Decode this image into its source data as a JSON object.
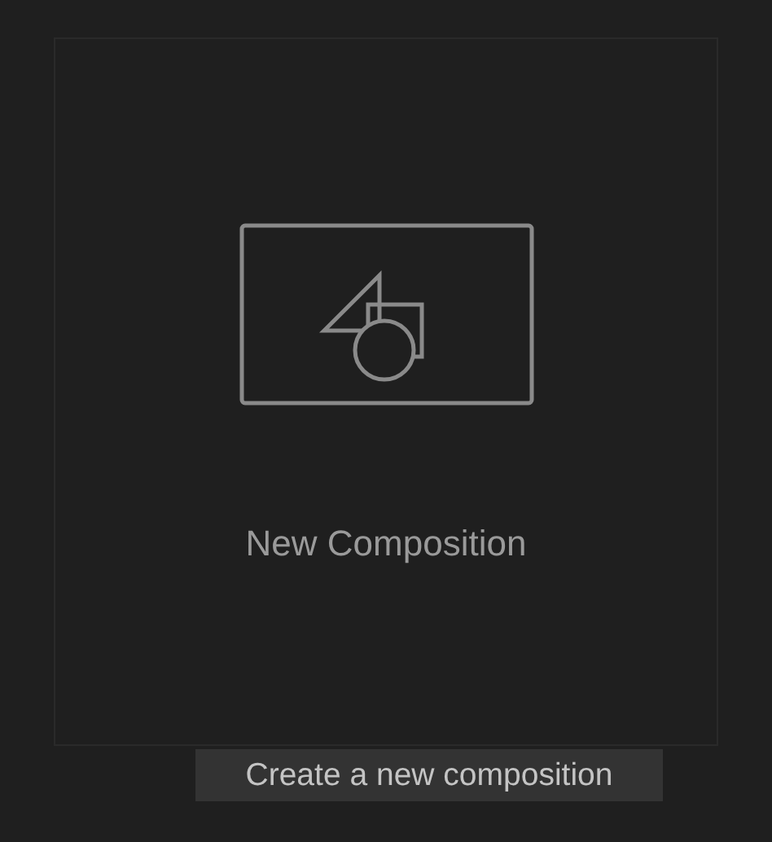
{
  "card": {
    "label": "New Composition"
  },
  "tooltip": {
    "text": "Create a new composition"
  }
}
